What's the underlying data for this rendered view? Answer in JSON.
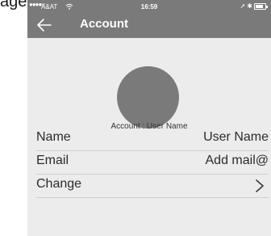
{
  "background_heading": "agement",
  "status_bar": {
    "signal": "●●●●○",
    "carrier": "A&AT",
    "time": "16:59",
    "location_glyph": "➚",
    "bluetooth_glyph": "✱"
  },
  "header": {
    "title": "Account",
    "back_icon": "back-arrow-icon"
  },
  "profile": {
    "caption": "Account : User Name",
    "avatar_color": "#7a7a7a"
  },
  "rows": [
    {
      "label": "Name",
      "value": "User Name"
    },
    {
      "label": "Email",
      "value": "Add mail@"
    },
    {
      "label": "Change",
      "icon": "chevron-right-icon"
    }
  ],
  "colors": {
    "header_bg": "#7a7a7a",
    "page_bg": "#ececec",
    "divider": "#cfcfcf"
  }
}
